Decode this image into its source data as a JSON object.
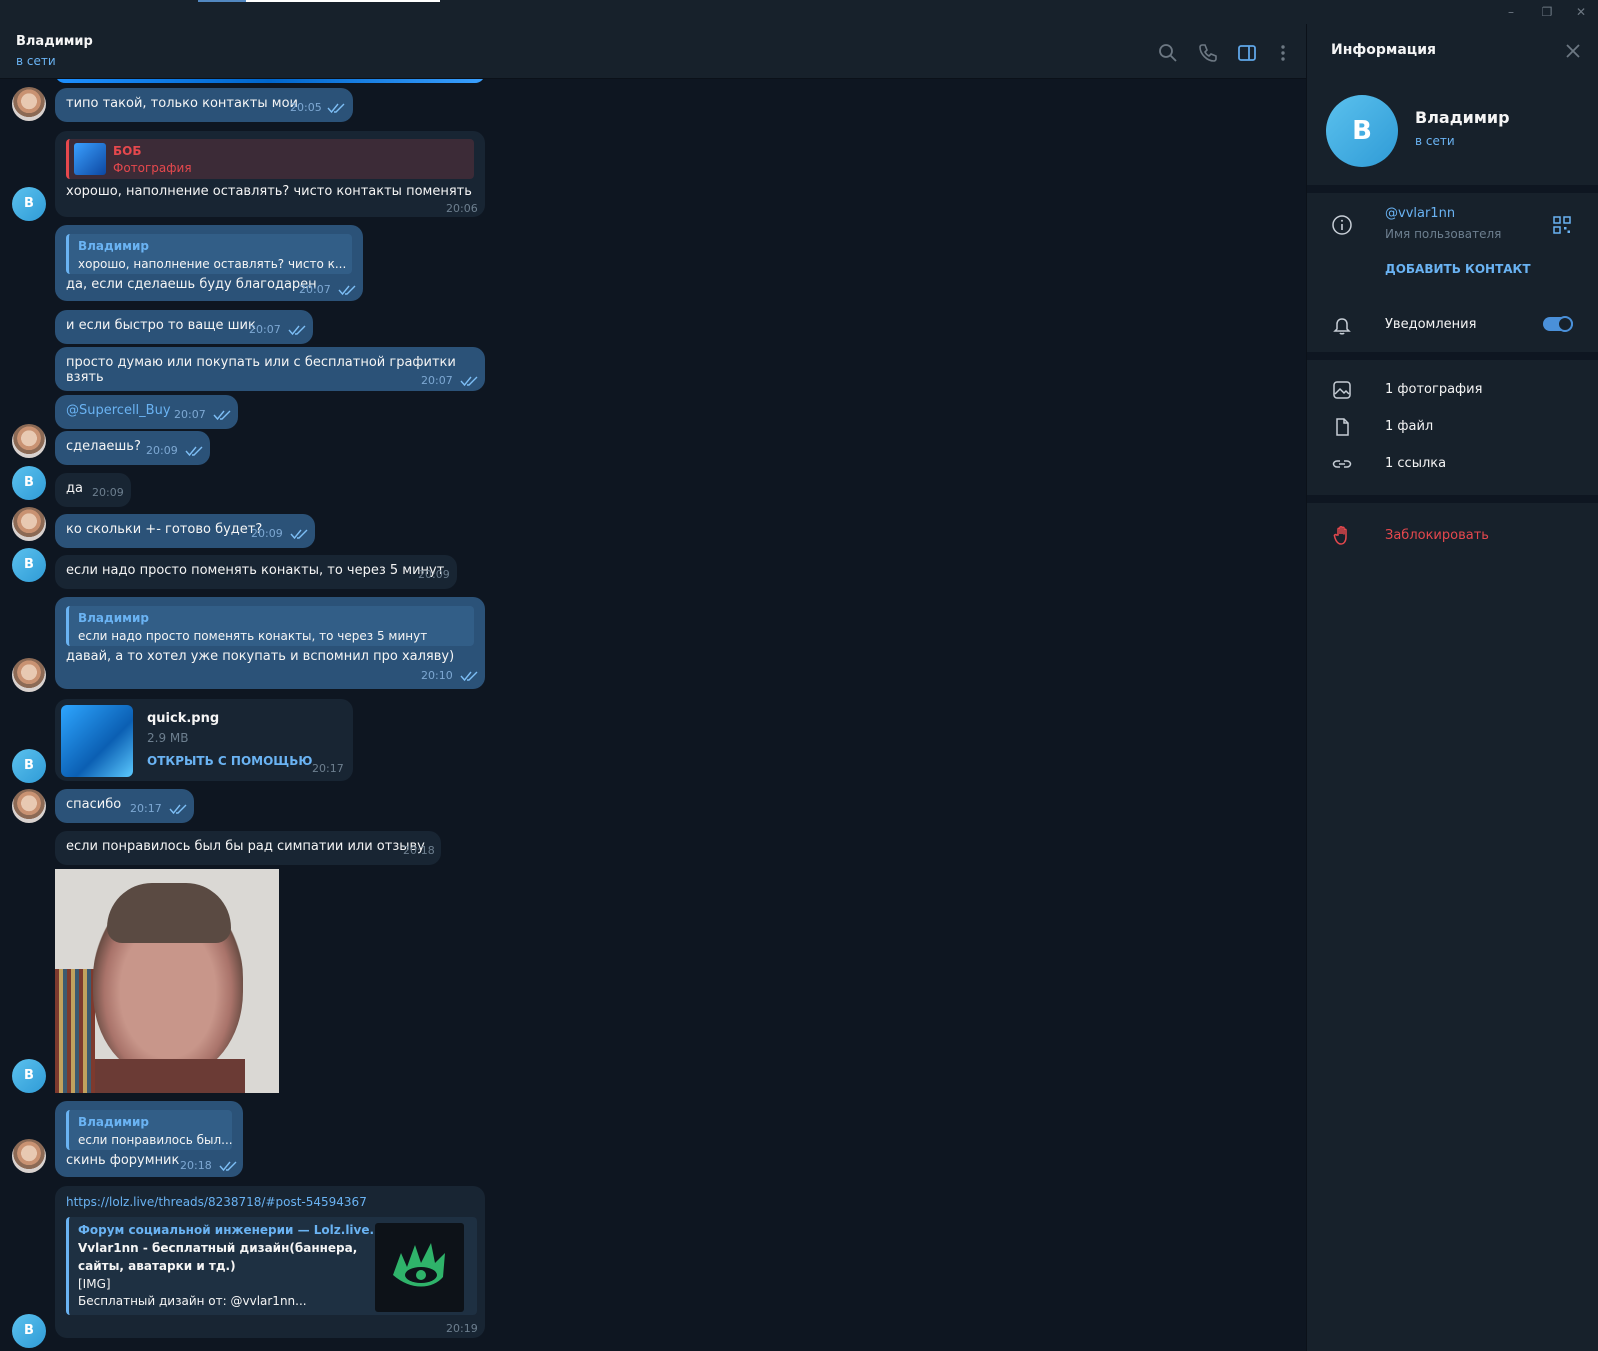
{
  "window": {
    "controls": [
      "–",
      "❐",
      "✕"
    ]
  },
  "header": {
    "name": "Владимир",
    "status": "в сети"
  },
  "messages": {
    "m1": {
      "text": "типо такой, только контакты мои",
      "time": "20:05"
    },
    "m2": {
      "reply_name": "БОБ",
      "reply_text": "Фотография",
      "text": "хорошо, наполнение оставлять? чисто контакты поменять",
      "time": "20:06"
    },
    "m3": {
      "reply_name": "Владимир",
      "reply_text": "хорошо, наполнение оставлять? чисто к...",
      "text": "да, если сделаешь буду благодарен",
      "time": "20:07"
    },
    "m4": {
      "text": "и если быстро то ваще шик",
      "time": "20:07"
    },
    "m5": {
      "text": "просто думаю или покупать или с бесплатной графитки взять",
      "time": "20:07"
    },
    "m6": {
      "text": "@Supercell_Buy",
      "time": "20:07"
    },
    "m7": {
      "text": "сделаешь?",
      "time": "20:09"
    },
    "m8": {
      "text": "да",
      "time": "20:09"
    },
    "m9": {
      "text": "ко скольки +- готово будет?",
      "time": "20:09"
    },
    "m10": {
      "text": "если надо просто поменять конакты, то через 5 минут",
      "time": "20:09"
    },
    "m11": {
      "reply_name": "Владимир",
      "reply_text": "если надо просто поменять конакты, то через 5 минут",
      "text": "давай, а то хотел уже покупать и вспомнил про халяву)",
      "time": "20:10"
    },
    "m12": {
      "file_name": "quick.png",
      "file_size": "2.9 MB",
      "action": "ОТКРЫТЬ С ПОМОЩЬЮ",
      "time": "20:17"
    },
    "m13": {
      "text": "спасибо",
      "time": "20:17"
    },
    "m14": {
      "text": "если понравилось был бы рад симпатии или отзыву",
      "time": "20:18"
    },
    "m15": {
      "reply_name": "Владимир",
      "reply_text": "если понравилось был...",
      "text": "скинь форумник",
      "time": "20:18"
    },
    "m16": {
      "url": "https://lolz.live/threads/8238718/#post-54594367",
      "preview_site": "Форум социальной инженерии — Lolz.live...",
      "preview_title_1": "Vvlar1nn - бесплатный дизайн(баннера,",
      "preview_title_2": "сайты, аватарки и тд.)",
      "preview_line_1": "[IMG]",
      "preview_line_2": "Бесплатный дизайн от: @vvlar1nn...",
      "time": "20:19"
    }
  },
  "avatar_letter": "В",
  "info": {
    "title": "Информация",
    "name": "Владимир",
    "status": "в сети",
    "username": "@vvlar1nn",
    "username_label": "Имя пользователя",
    "add_contact": "ДОБАВИТЬ КОНТАКТ",
    "notifications": "Уведомления",
    "notifications_on": true,
    "photos": "1 фотография",
    "files": "1 файл",
    "links": "1 ссылка",
    "block": "Заблокировать"
  },
  "colors": {
    "accent": "#6ab3f3",
    "outgoing": "#2b5278",
    "incoming": "#182533",
    "danger": "#e5484d"
  }
}
